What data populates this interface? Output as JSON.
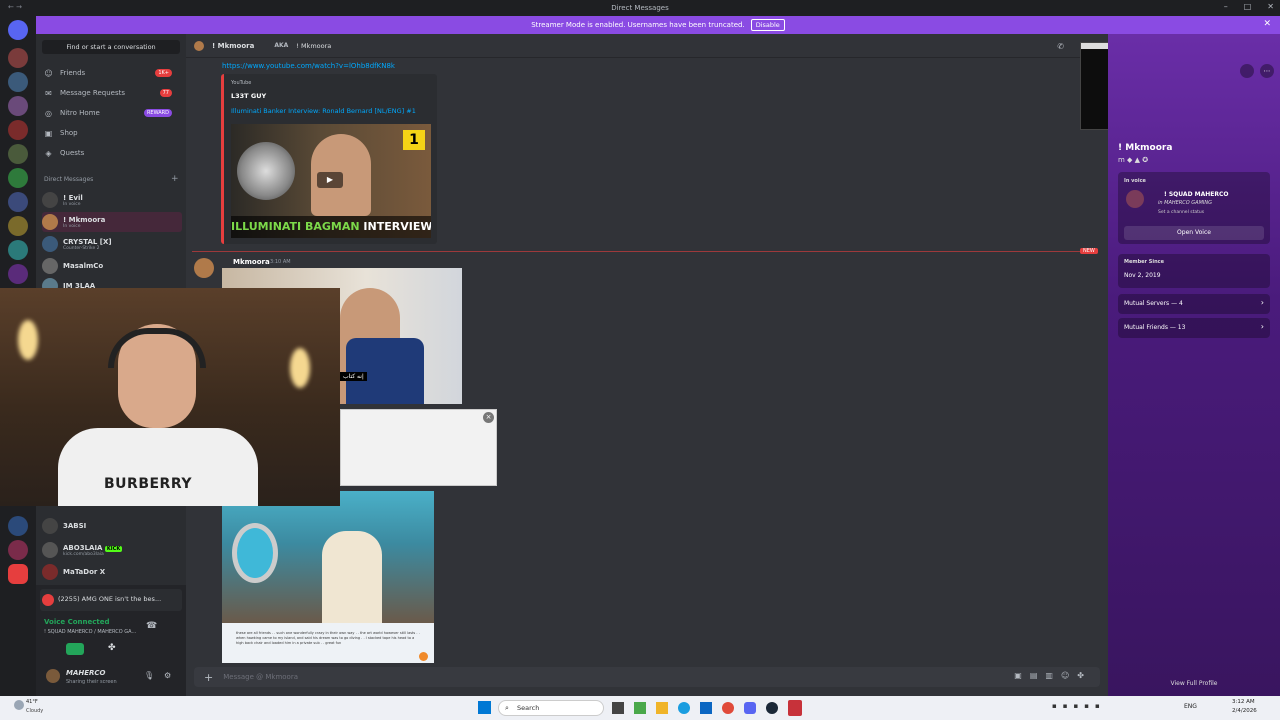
{
  "titlebar": {
    "title": "Direct Messages",
    "left_hint": "← →"
  },
  "streamer_banner": {
    "text": "Streamer Mode is enabled. Usernames have been truncated.",
    "button": "Disable",
    "close": "✕"
  },
  "dm_sidebar": {
    "search_placeholder": "Find or start a conversation",
    "nav": [
      {
        "label": "Friends",
        "badge": "1K+"
      },
      {
        "label": "Message Requests",
        "badge": "77"
      },
      {
        "label": "Nitro Home",
        "badge": "REWARD"
      },
      {
        "label": "Shop",
        "badge": ""
      },
      {
        "label": "Quests",
        "badge": ""
      }
    ],
    "section_title": "Direct Messages",
    "add": "+",
    "dms": [
      {
        "name": "! Evil",
        "status": "In voice"
      },
      {
        "name": "! Mkmoora",
        "status": "In voice"
      },
      {
        "name": "CRYSTAL [X]",
        "status": "Counter-Strike 2"
      },
      {
        "name": "MasalmCo",
        "status": ""
      },
      {
        "name": "IM 3LAA",
        "status": ""
      }
    ],
    "dms_lower": [
      {
        "name": "3ABSI",
        "status": ""
      },
      {
        "name": "ABO3LAIA",
        "status": "kick.com/abo3laia"
      },
      {
        "name": "MaTaDor X",
        "status": ""
      }
    ],
    "kick_tag": "KICK"
  },
  "user_panel": {
    "activity": "(2255) AMG ONE isn't the bes...",
    "voice_status": "Voice Connected",
    "voice_channel": "! SQUAD MAHERCO / MAHERCO GA...",
    "username": "MAHERCO",
    "user_status": "Sharing their screen"
  },
  "chat": {
    "header_name": "! Mkmoora",
    "header_aka_label": "AKA",
    "header_aka": "! Mkmoora",
    "link": "https://www.youtube.com/watch?v=lOhb8dfKN8k",
    "embed_provider": "YouTube",
    "embed_author": "L33T GUY",
    "embed_title": "Illuminati Banker Interview: Ronald Bernard [NL/ENG] #1",
    "thumb_caption_left": "ILLUMINATI BAGMAN",
    "thumb_caption_right": "INTERVIEW",
    "thumb_badge": "1",
    "new_tag": "NEW",
    "message_author": "Mkmoora",
    "message_time": "3:10 AM",
    "video_subtitle": "إنه كتاب",
    "composer_placeholder": "Message @ Mkmoora",
    "screenshot_caption": "these are all friends . . such one wonderfully crazy in their own way . . the art world however still lasts . . when hawking came to my island, and said his dream was to go diving . . I stacked tape his head to a high back chair and loaded him in a private sub . . great fun"
  },
  "webcam": {
    "shirt_text": "BURBERRY"
  },
  "profile": {
    "name": "! Mkmoora",
    "in_voice_label": "In voice",
    "voice_server": "! SQUAD MAHERCO",
    "voice_sub": "in MAHERCO GAMING",
    "voice_status": "Set a channel status",
    "open_voice": "Open Voice",
    "member_since_label": "Member Since",
    "member_since": "Nov 2, 2019",
    "mutual_servers": "Mutual Servers — 4",
    "mutual_friends": "Mutual Friends — 13",
    "view_full": "View Full Profile"
  },
  "taskbar": {
    "weather_temp": "41°F",
    "weather_desc": "Cloudy",
    "search": "Search",
    "lang": "ENG",
    "time": "3:12 AM",
    "date": "2/4/2026"
  },
  "colors": {
    "accent": "#8a4be3",
    "danger": "#e63e3e",
    "link": "#00a8fc",
    "bg": "#313338"
  }
}
